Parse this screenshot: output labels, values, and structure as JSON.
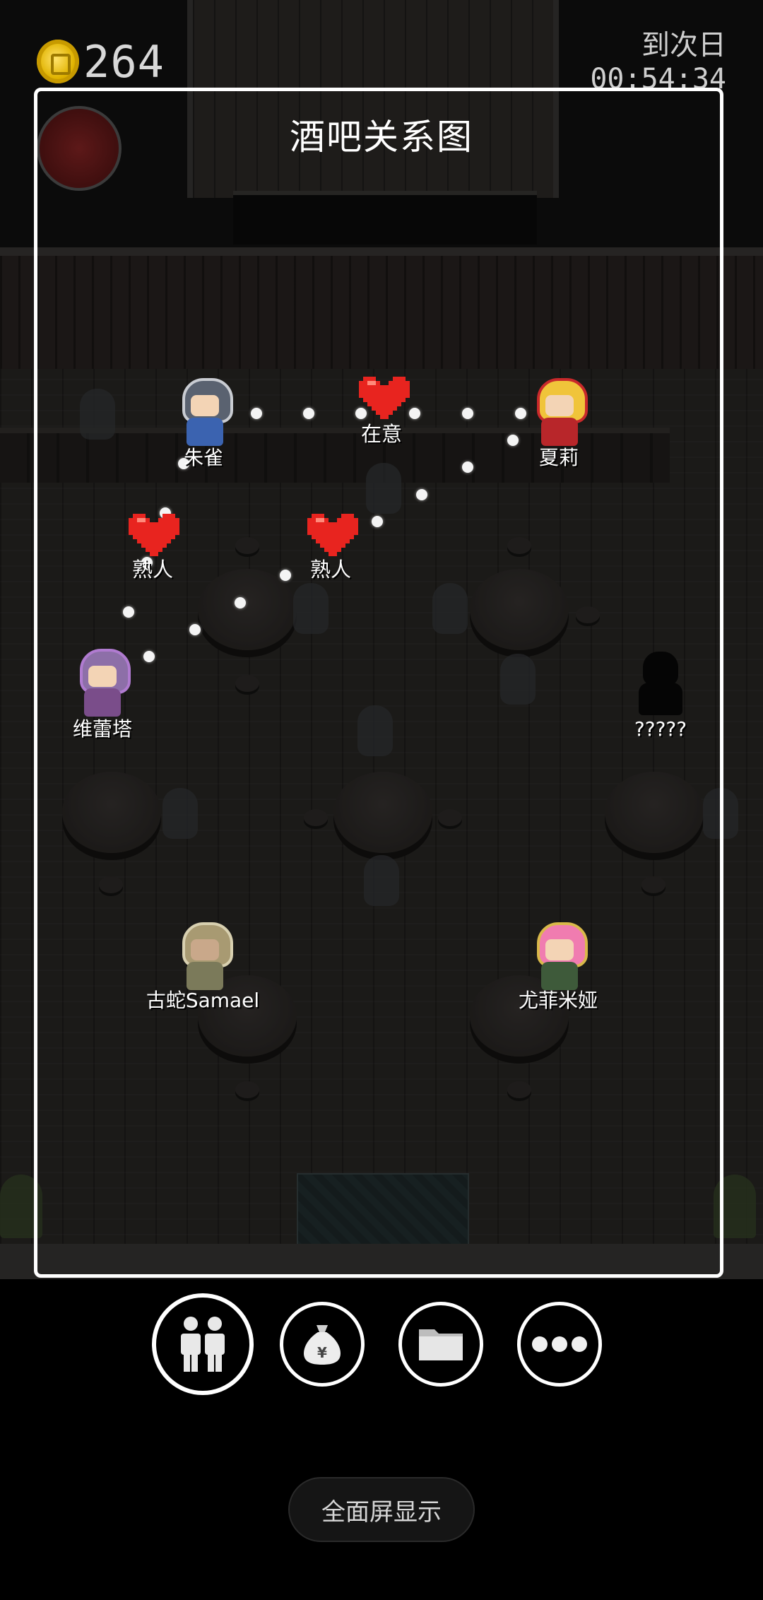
{
  "hud": {
    "gold": "264",
    "next_day_label": "到次日",
    "countdown": "00:54:34"
  },
  "panel": {
    "title": "酒吧关系图"
  },
  "characters": {
    "zhuque": "朱雀",
    "xiali": "夏莉",
    "weileita": "维蕾塔",
    "unknown": "?????",
    "gushe": "古蛇Samael",
    "youfei": "尤菲米娅"
  },
  "relations": {
    "care": "在意",
    "acquaintance": "熟人"
  },
  "icons": {
    "coin": "gold-coin-icon",
    "weibo": "weibo-icon",
    "heart": "heart-icon",
    "relations": "people-icon",
    "bag": "money-bag-icon",
    "files": "folder-icon",
    "more": "more-dots-icon"
  },
  "colors": {
    "heart": "#e8241f",
    "panel_border": "#ffffff"
  },
  "footer": {
    "fullscreen_label": "全面屏显示"
  }
}
